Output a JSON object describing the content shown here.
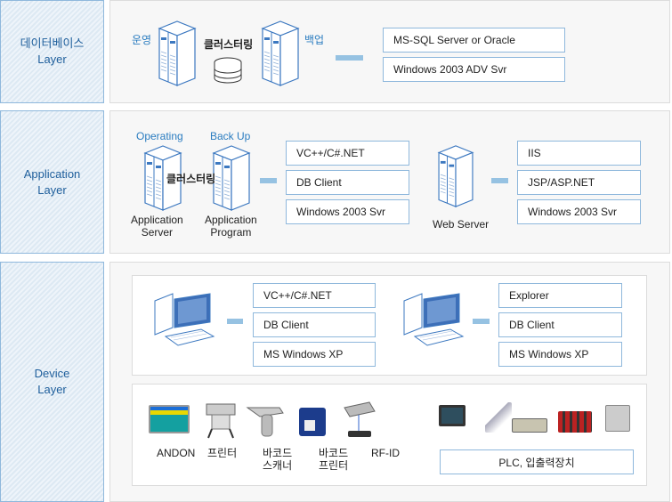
{
  "layers": [
    {
      "title": "데이터베이스",
      "sub": "Layer"
    },
    {
      "title": "Application",
      "sub": "Layer"
    },
    {
      "title": "Device",
      "sub": "Layer"
    }
  ],
  "db": {
    "operate": "운영",
    "cluster": "클러스터링",
    "backup": "백업",
    "boxes": [
      "MS-SQL Server or Oracle",
      "Windows 2003 ADV Svr"
    ]
  },
  "app": {
    "operating": "Operating",
    "backup": "Back Up",
    "cluster": "클러스터링",
    "server1": [
      "Application",
      "Server"
    ],
    "server2": [
      "Application",
      "Program"
    ],
    "boxes": [
      "VC++/C#.NET",
      "DB Client",
      "Windows 2003 Svr"
    ],
    "web_label": "Web Server",
    "web_boxes": [
      "IIS",
      "JSP/ASP.NET",
      "Windows 2003 Svr"
    ]
  },
  "device": {
    "pc1_boxes": [
      "VC++/C#.NET",
      "DB Client",
      "MS Windows XP"
    ],
    "pc2_boxes": [
      "Explorer",
      "DB Client",
      "MS Windows XP"
    ],
    "devices": [
      {
        "l1": "ANDON",
        "l2": ""
      },
      {
        "l1": "프린터",
        "l2": ""
      },
      {
        "l1": "바코드",
        "l2": "스캐너"
      },
      {
        "l1": "바코드",
        "l2": "프린터"
      },
      {
        "l1": "RF-ID",
        "l2": ""
      }
    ],
    "plc": "PLC, 입출력장치"
  },
  "colors": {
    "accent": "#2a7cc0",
    "connector": "#96c2e2",
    "border": "#8fb8dc"
  }
}
